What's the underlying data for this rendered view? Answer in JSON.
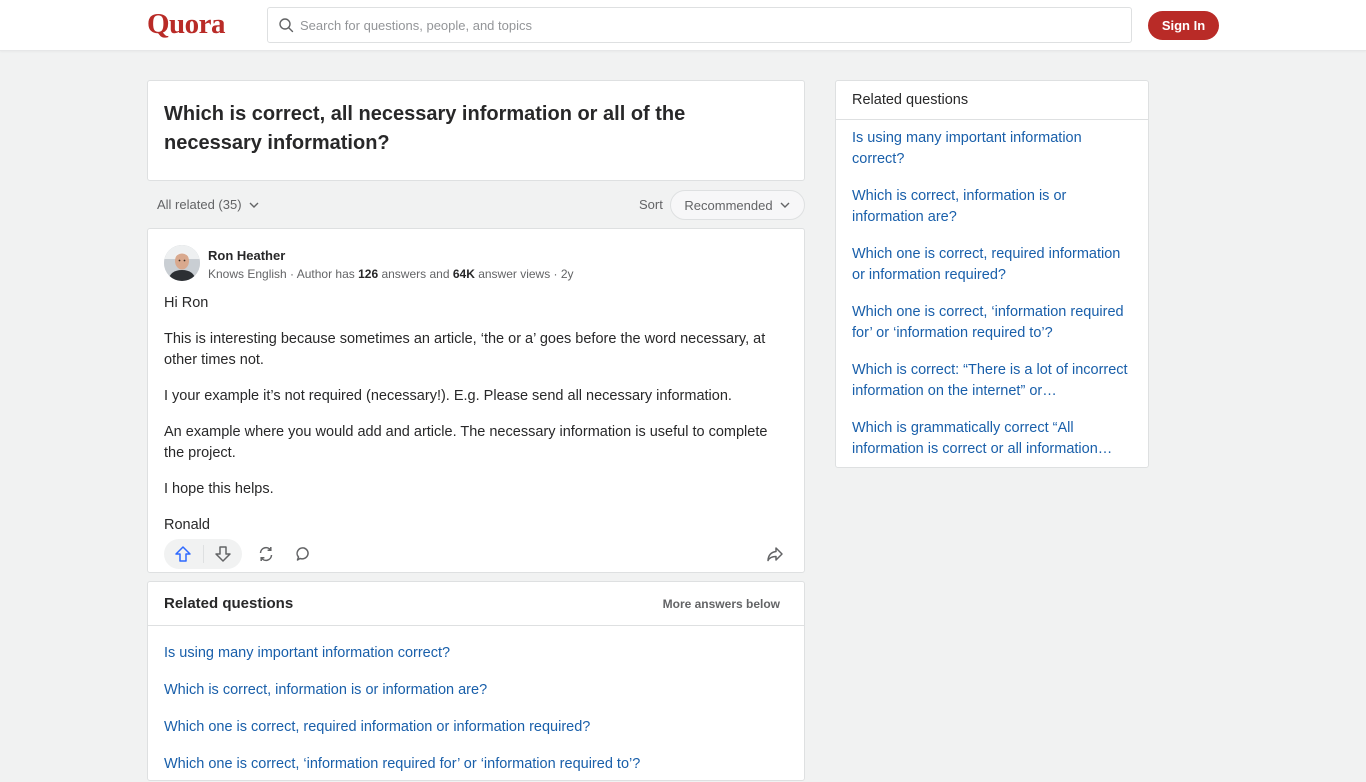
{
  "header": {
    "logo": "Quora",
    "search_placeholder": "Search for questions, people, and topics",
    "signin_label": "Sign In"
  },
  "question": {
    "title": "Which is correct, all necessary information or all of the necessary information?"
  },
  "filters": {
    "all_related": "All related (35)",
    "sort_label": "Sort",
    "sort_value": "Recommended"
  },
  "answer": {
    "author_name": "Ron Heather",
    "meta_prefix": "Knows English · Author has ",
    "answers_count": "126",
    "meta_mid": " answers and ",
    "views_count": "64K",
    "meta_suffix": " answer views · 2y",
    "paragraphs": [
      "Hi Ron",
      "This is interesting because sometimes an article, ‘the or a’ goes before the word necessary, at other times not.",
      "I your example it’s not required (necessary!). E.g. Please send all necessary information.",
      "An example where you would add and article. The necessary information is useful to complete the project.",
      "I hope this helps.",
      "Ronald"
    ]
  },
  "related_inline": {
    "title": "Related questions",
    "more_label": "More answers below",
    "items": [
      "Is using many important information correct?",
      "Which is correct, information is or information are?",
      "Which one is correct, required information or information required?",
      "Which one is correct, ‘information required for’ or ‘information required to’?"
    ]
  },
  "sidebar": {
    "title": "Related questions",
    "items": [
      "Is using many important information correct?",
      "Which is correct, information is or information are?",
      "Which one is correct, required information or information required?",
      "Which one is correct, ‘information required for’ or ‘information required to’?",
      "Which is correct: “There is a lot of incorrect information on the internet” or…",
      "Which is grammatically correct “All information is correct or all information…"
    ]
  },
  "colors": {
    "brand": "#b92b27",
    "link": "#195faa",
    "upvote": "#2e69ff"
  }
}
